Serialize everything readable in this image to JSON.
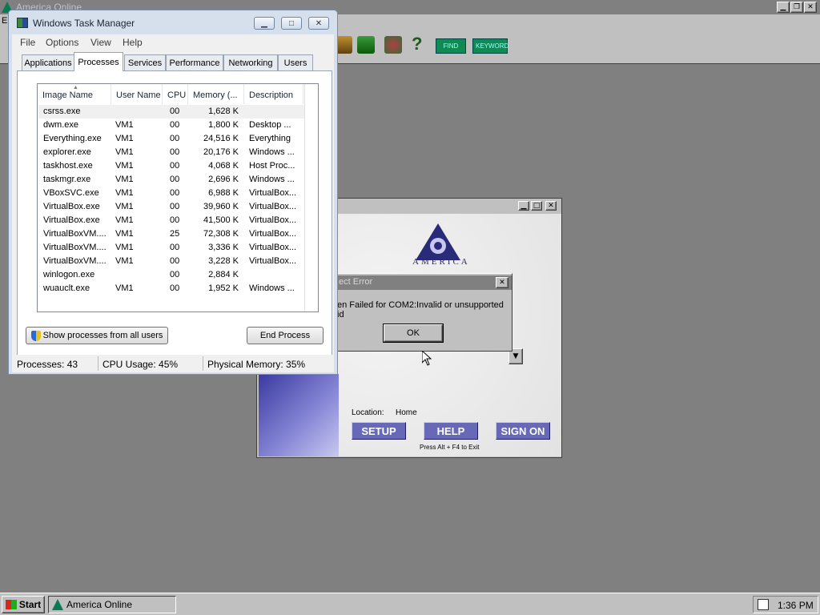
{
  "aol_main": {
    "title": "America Online",
    "toolbar_labels": [
      "FIND",
      "KEYWORD"
    ]
  },
  "task_manager": {
    "title": "Windows Task Manager",
    "menu": [
      "File",
      "Options",
      "View",
      "Help"
    ],
    "tabs": [
      "Applications",
      "Processes",
      "Services",
      "Performance",
      "Networking",
      "Users"
    ],
    "active_tab": "Processes",
    "columns": [
      "Image Name",
      "User Name",
      "CPU",
      "Memory (...",
      "Description"
    ],
    "processes": [
      {
        "name": "csrss.exe",
        "user": "",
        "cpu": "00",
        "mem": "1,628 K",
        "desc": ""
      },
      {
        "name": "dwm.exe",
        "user": "VM1",
        "cpu": "00",
        "mem": "1,800 K",
        "desc": "Desktop ..."
      },
      {
        "name": "Everything.exe",
        "user": "VM1",
        "cpu": "00",
        "mem": "24,516 K",
        "desc": "Everything"
      },
      {
        "name": "explorer.exe",
        "user": "VM1",
        "cpu": "00",
        "mem": "20,176 K",
        "desc": "Windows ..."
      },
      {
        "name": "taskhost.exe",
        "user": "VM1",
        "cpu": "00",
        "mem": "4,068 K",
        "desc": "Host Proc..."
      },
      {
        "name": "taskmgr.exe",
        "user": "VM1",
        "cpu": "00",
        "mem": "2,696 K",
        "desc": "Windows ..."
      },
      {
        "name": "VBoxSVC.exe",
        "user": "VM1",
        "cpu": "00",
        "mem": "6,988 K",
        "desc": "VirtualBox..."
      },
      {
        "name": "VirtualBox.exe",
        "user": "VM1",
        "cpu": "00",
        "mem": "39,960 K",
        "desc": "VirtualBox..."
      },
      {
        "name": "VirtualBox.exe",
        "user": "VM1",
        "cpu": "00",
        "mem": "41,500 K",
        "desc": "VirtualBox..."
      },
      {
        "name": "VirtualBoxVM....",
        "user": "VM1",
        "cpu": "25",
        "mem": "72,308 K",
        "desc": "VirtualBox..."
      },
      {
        "name": "VirtualBoxVM....",
        "user": "VM1",
        "cpu": "00",
        "mem": "3,336 K",
        "desc": "VirtualBox..."
      },
      {
        "name": "VirtualBoxVM....",
        "user": "VM1",
        "cpu": "00",
        "mem": "3,228 K",
        "desc": "VirtualBox..."
      },
      {
        "name": "winlogon.exe",
        "user": "",
        "cpu": "00",
        "mem": "2,884 K",
        "desc": ""
      },
      {
        "name": "wuauclt.exe",
        "user": "VM1",
        "cpu": "00",
        "mem": "1,952 K",
        "desc": "Windows ..."
      }
    ],
    "show_all_label": "Show processes from all users",
    "end_process_label": "End Process",
    "status": {
      "processes": "Processes: 43",
      "cpu": "CPU Usage: 45%",
      "memory": "Physical Memory: 35%"
    }
  },
  "signon": {
    "logo_top": "AMERICA",
    "location_label": "Location:",
    "location_value": "Home",
    "buttons": [
      "SETUP",
      "HELP",
      "SIGN ON"
    ],
    "exit_hint": "Press Alt + F4 to Exit"
  },
  "error_dialog": {
    "title": "ect Error",
    "message": "en Failed for COM2:Invalid or unsupported id",
    "ok_label": "OK"
  },
  "taskbar": {
    "start_label": "Start",
    "tasks": [
      "America  Online"
    ],
    "clock": "1:36 PM"
  }
}
